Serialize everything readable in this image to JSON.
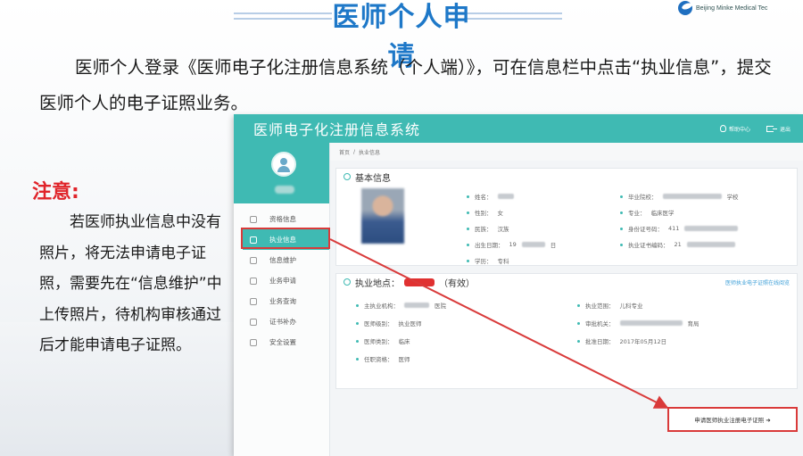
{
  "slide": {
    "title": "医师个人申请",
    "logo_text": "Beijing Minke Medical Tec",
    "intro": "医师个人登录《医师电子化注册信息系统（个人端）》，可在信息栏中点击“执业信息”，提交医师个人的电子证照业务。",
    "note_title": "注意:",
    "note_body": "若医师执业信息中没有照片，将无法申请电子证照，需要先在“信息维护”中上传照片，待机构审核通过后才能申请电子证照。"
  },
  "app": {
    "title": "医师电子化注册信息系统",
    "topbar_links": [
      "帮助中心",
      "退出"
    ],
    "breadcrumb": [
      "首页",
      "执业信息"
    ],
    "menu": [
      {
        "label": "资格信息",
        "active": false
      },
      {
        "label": "执业信息",
        "active": true
      },
      {
        "label": "信息维护",
        "active": false
      },
      {
        "label": "业务申请",
        "active": false
      },
      {
        "label": "业务查询",
        "active": false
      },
      {
        "label": "证书补办",
        "active": false
      },
      {
        "label": "安全设置",
        "active": false
      }
    ],
    "basic_info": {
      "heading": "基本信息",
      "left": [
        {
          "label": "姓名：",
          "value": ""
        },
        {
          "label": "性别：",
          "value": "女"
        },
        {
          "label": "民族：",
          "value": "汉族"
        },
        {
          "label": "出生日期：",
          "value": "19"
        },
        {
          "label": "学历：",
          "value": "专科"
        }
      ],
      "right": [
        {
          "label": "毕业院校：",
          "value": "学校"
        },
        {
          "label": "专业：",
          "value": "临床医学"
        },
        {
          "label": "身份证号码：",
          "value": "411"
        },
        {
          "label": "执业证书编码：",
          "value": "21"
        }
      ],
      "date_suffix": "日"
    },
    "practice_info": {
      "heading": "执业地点：",
      "status": "（有效）",
      "link": "医师执业电子证照在线阅览",
      "left": [
        {
          "label": "主执业机构：",
          "value": "医院"
        },
        {
          "label": "医师级别：",
          "value": "执业医师"
        },
        {
          "label": "医师类别：",
          "value": "临床"
        },
        {
          "label": "任职资格：",
          "value": "医师"
        }
      ],
      "right": [
        {
          "label": "执业范围：",
          "value": "儿科专业"
        },
        {
          "label": "审批机关：",
          "value": "育局"
        },
        {
          "label": "批准日期：",
          "value": "2017年05月12日"
        }
      ],
      "apply_button": "申请医师执业注册电子证照 ➜"
    }
  },
  "colors": {
    "title_blue": "#1e78c8",
    "teal": "#3fbab3",
    "note_red": "#e0242a",
    "highlight_red": "#d93a3a"
  }
}
